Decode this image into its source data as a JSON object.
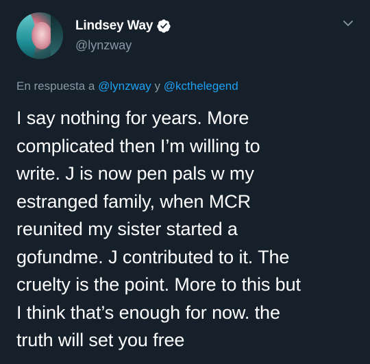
{
  "colors": {
    "background": "#15202b",
    "text_primary": "#ffffff",
    "text_secondary": "#8899a6",
    "link": "#1da1f2",
    "verified_badge": "#ffffff"
  },
  "author": {
    "display_name": "Lindsey Way",
    "handle": "@lynzway",
    "verified": true,
    "avatar_icon": "avatar"
  },
  "menu": {
    "icon": "chevron-down-icon"
  },
  "reply": {
    "prefix": "En respuesta a ",
    "mention_1": "@lynzway",
    "joiner": " y ",
    "mention_2": "@kcthelegend"
  },
  "tweet": {
    "text": "I say nothing for years. More\ncomplicated then I’m willing to\nwrite. J is now pen pals w my\nestranged family, when MCR\nreunited my sister started a\ngofundme. J contributed to it. The\ncruelty is the point. More to this but\nI think that’s enough for now. the\ntruth will set you free"
  }
}
